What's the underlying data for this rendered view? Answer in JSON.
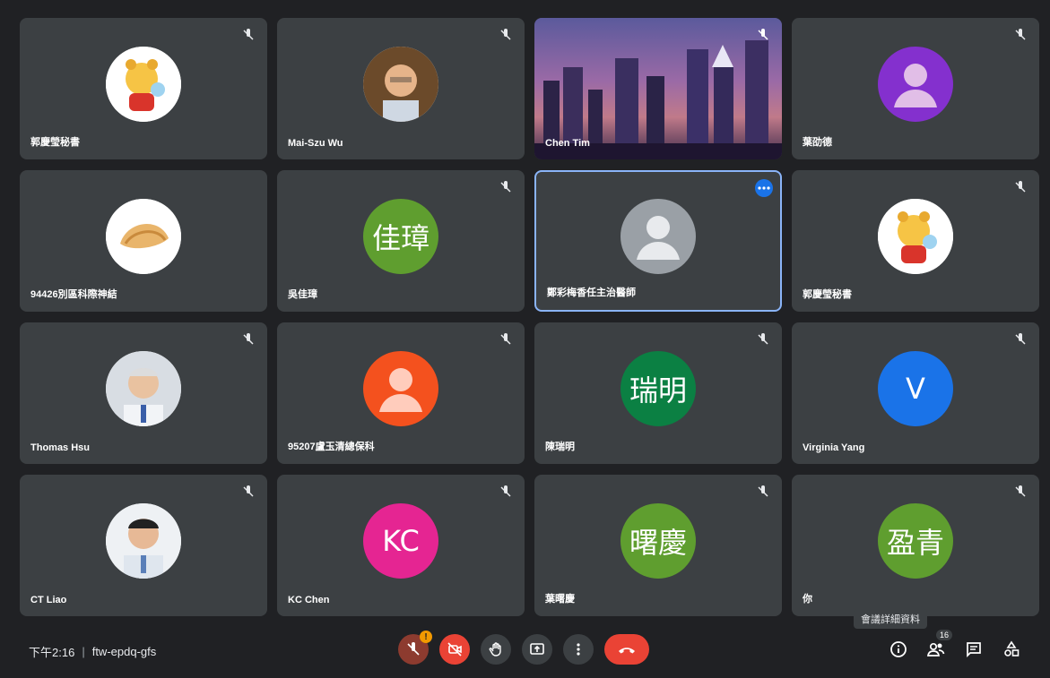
{
  "participants": [
    {
      "name": "郭慶瑩秘書",
      "type": "photo",
      "icon": "pooh-avatar"
    },
    {
      "name": "Mai-Szu Wu",
      "type": "photo",
      "icon": "person-photo"
    },
    {
      "name": "Chen Tim",
      "type": "video",
      "icon": "city-night-video"
    },
    {
      "name": "葉劭德",
      "type": "default",
      "color": "#8430ce"
    },
    {
      "name": "94426別區科際神結",
      "type": "photo",
      "icon": "fortune-cookie-avatar"
    },
    {
      "name": "吳佳璋",
      "type": "initials",
      "initials": "佳璋",
      "color": "#5f9e2f"
    },
    {
      "name": "鄭彩梅香任主治醫師",
      "type": "default",
      "color": "#9aa0a6"
    },
    {
      "name": "郭慶瑩秘書",
      "type": "photo",
      "icon": "pooh-avatar"
    },
    {
      "name": "Thomas Hsu",
      "type": "photo",
      "icon": "person-photo"
    },
    {
      "name": "95207盧玉清總保科",
      "type": "default",
      "color": "#f4511e"
    },
    {
      "name": "陳瑞明",
      "type": "initials",
      "initials": "瑞明",
      "color": "#0b8043"
    },
    {
      "name": "Virginia Yang",
      "type": "initials",
      "initials": "V",
      "color": "#1a73e8"
    },
    {
      "name": "CT Liao",
      "type": "photo",
      "icon": "person-photo"
    },
    {
      "name": "KC Chen",
      "type": "initials",
      "initials": "KC",
      "color": "#e52592"
    },
    {
      "name": "葉曙慶",
      "type": "initials",
      "initials": "曙慶",
      "color": "#5f9e2f"
    },
    {
      "name": "你",
      "type": "initials",
      "initials": "盈青",
      "color": "#5f9e2f"
    }
  ],
  "tooltip": "會議詳細資料",
  "bottom": {
    "time": "下午2:16",
    "separator": "|",
    "meeting_code": "ftw-epdq-gfs",
    "warning_badge": "!",
    "people_count": "16"
  },
  "colors": {
    "hangup": "#ea4335",
    "active_border": "#8ab4f8",
    "tile_bg": "#3c4043"
  }
}
